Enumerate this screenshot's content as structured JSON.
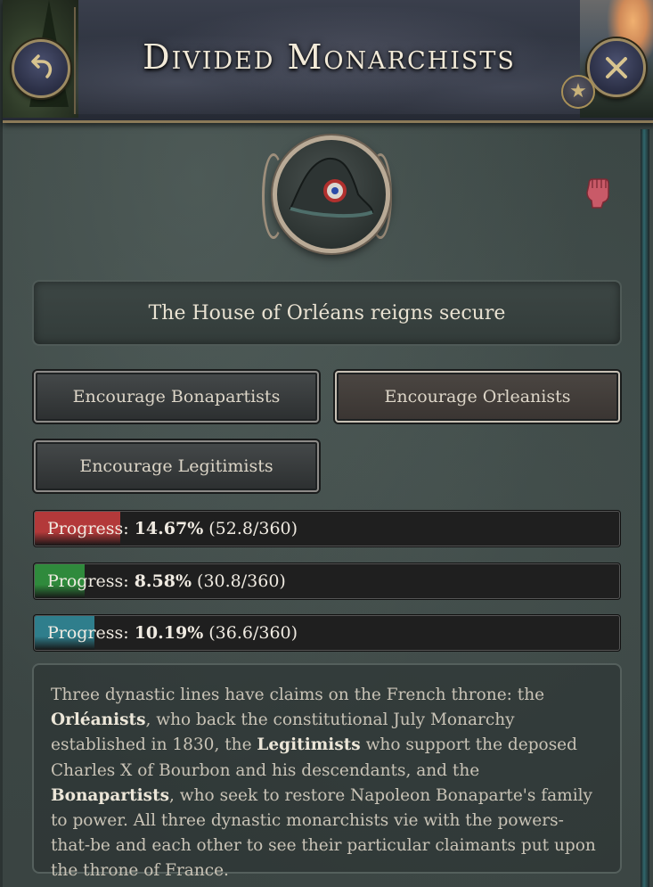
{
  "header": {
    "title": "Divided Monarchists"
  },
  "icons": {
    "back": "back-arrow-icon",
    "close": "close-icon",
    "star": "star-icon",
    "emblem": "bicorne-hat-icon",
    "fist": "raised-fist-icon"
  },
  "status": {
    "text": "The House of Orléans reigns secure"
  },
  "buttons": {
    "bonapartists": "Encourage Bonapartists",
    "orleanists": "Encourage Orleanists",
    "legitimists": "Encourage Legitimists"
  },
  "progress": [
    {
      "label": "Progress:",
      "percent": "14.67%",
      "detail": "(52.8/360)",
      "fraction": 0.1467,
      "color": "#b3393a"
    },
    {
      "label": "Progress:",
      "percent": "8.58%",
      "detail": "(30.8/360)",
      "fraction": 0.0858,
      "color": "#2f8a3c"
    },
    {
      "label": "Progress:",
      "percent": "10.19%",
      "detail": "(36.6/360)",
      "fraction": 0.1019,
      "color": "#2f7e8c"
    }
  ],
  "description": {
    "p1": "Three dynastic lines have claims on the French throne: the ",
    "b1": "Orléanists",
    "p2": ", who back the constitutional July Monarchy established in 1830, the ",
    "b2": "Legitimists",
    "p3": " who support the deposed Charles X of Bourbon and his descendants, and the ",
    "b3": "Bonapartists",
    "p4": ", who seek to restore Napoleon Bonaparte's family to power. All three dynastic monarchists vie with the powers-that-be and each other to see their particular claimants put upon the throne of France."
  }
}
